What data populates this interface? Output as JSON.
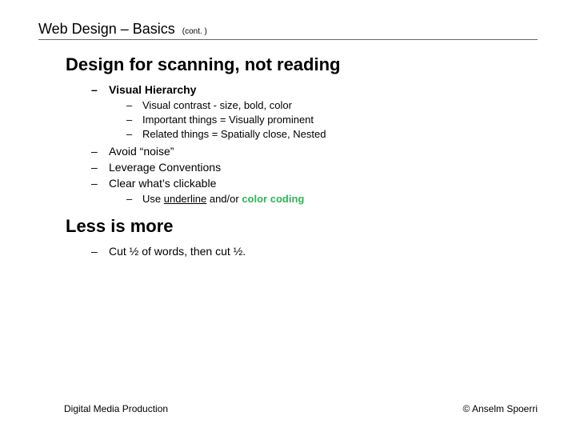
{
  "header": {
    "title": "Web Design – Basics",
    "cont": "(cont. )"
  },
  "section1": {
    "title": "Design for scanning, not reading",
    "item_vh": "Visual Hierarchy",
    "vh_sub1": "Visual contrast - size, bold, color",
    "vh_sub2": "Important things = Visually prominent",
    "vh_sub3": "Related things = Spatially close, Nested",
    "item_noise": "Avoid “noise”",
    "item_conv": "Leverage Conventions",
    "item_click": "Clear what’s clickable",
    "click_sub": {
      "prefix": "Use ",
      "underline": "underline",
      "mid": " and/or ",
      "color": "color coding"
    }
  },
  "section2": {
    "title": "Less is more",
    "item_cut": "Cut ½ of words, then cut ½."
  },
  "footer": {
    "left": "Digital Media Production",
    "right": "© Anselm Spoerri"
  }
}
